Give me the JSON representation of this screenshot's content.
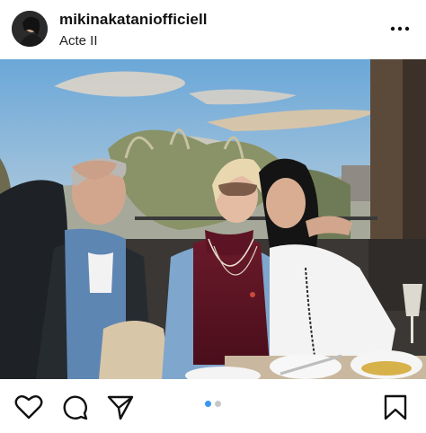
{
  "post": {
    "username": "mikinakataniofficiell",
    "subtitle": "Acte II"
  },
  "icons": {
    "more": "more-horizontal-icon",
    "like": "heart-icon",
    "comment": "comment-icon",
    "share": "send-icon",
    "save": "bookmark-icon"
  },
  "carousel": {
    "total": 2,
    "active": 1
  },
  "colors": {
    "active_dot": "#3897f0",
    "inactive_dot": "#c7c7c7",
    "text": "#111111"
  }
}
